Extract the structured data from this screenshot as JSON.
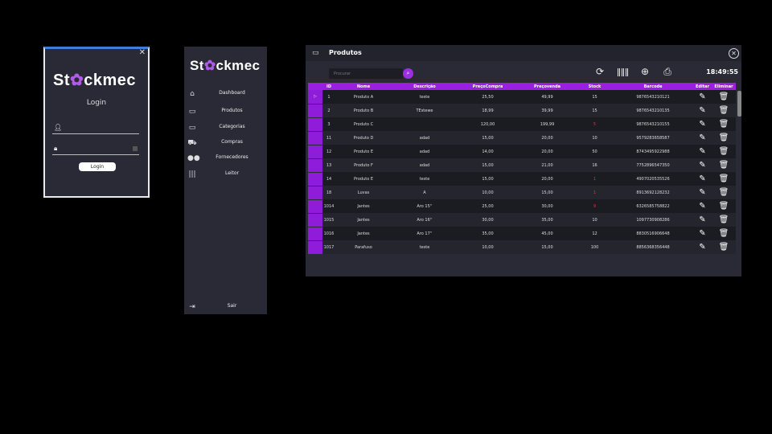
{
  "brand": {
    "logo_pre": "St",
    "logo_post": "ckmec",
    "logo_icon": "gear-icon",
    "accent": "#9b1fe0"
  },
  "login": {
    "title": "Login",
    "user_icon": "user-icon",
    "lock_icon": "lock-icon",
    "button": "Login"
  },
  "sidebar": {
    "items": [
      {
        "label": "Dashboard",
        "icon": "home-icon"
      },
      {
        "label": "Produtos",
        "icon": "laptop-icon"
      },
      {
        "label": "Categorias",
        "icon": "laptop-icon"
      },
      {
        "label": "Compras",
        "icon": "cart-icon"
      },
      {
        "label": "Fornecedores",
        "icon": "users-icon"
      },
      {
        "label": "Leitor",
        "icon": "barcode-icon"
      }
    ],
    "logout": {
      "label": "Sair",
      "icon": "logout-icon"
    }
  },
  "products": {
    "window_title": "Produtos",
    "search_placeholder": "Procurar",
    "time": "18:49:55",
    "columns": [
      "ID",
      "Nome",
      "Descrição",
      "PreçoCompra",
      "Preçovenda",
      "Stock",
      "Barcode",
      "Editar",
      "Eliminar"
    ],
    "rows": [
      [
        "1",
        "Produto A",
        "teste",
        "25,50",
        "49,99",
        "15",
        "9876543210121"
      ],
      [
        "2",
        "Produto B",
        "TEstewe",
        "18,99",
        "39,99",
        "15",
        "9876543210135"
      ],
      [
        "3",
        "Produto C",
        "",
        "120,00",
        "199,99",
        "5",
        "9876543210155"
      ],
      [
        "11",
        "Produto D",
        "adad",
        "15,00",
        "20,00",
        "10",
        "9579283658587"
      ],
      [
        "12",
        "Produto E",
        "adad",
        "14,00",
        "20,00",
        "50",
        "8743495922988"
      ],
      [
        "13",
        "Produto F",
        "adad",
        "15,00",
        "21,00",
        "16",
        "7752896547350"
      ],
      [
        "14",
        "Produto E",
        "teste",
        "15,00",
        "20,00",
        "1",
        "4907020535526"
      ],
      [
        "18",
        "Luvas",
        "A",
        "10,00",
        "15,00",
        "1",
        "8913692128232"
      ],
      [
        "1014",
        "Jantes",
        "Aro 15''",
        "25,00",
        "30,00",
        "9",
        "6326585758822"
      ],
      [
        "1015",
        "Jantes",
        "Aro 16''",
        "30,00",
        "35,00",
        "10",
        "1097730908286"
      ],
      [
        "1016",
        "Jantes",
        "Aro 17''",
        "35,00",
        "45,00",
        "12",
        "8830516906648"
      ],
      [
        "1017",
        "Parafuso",
        "teste",
        "10,00",
        "15,00",
        "100",
        "8856368356448"
      ]
    ],
    "low_stock_rows": [
      2,
      6,
      7,
      8
    ],
    "low_stock_color": "#e33333"
  }
}
